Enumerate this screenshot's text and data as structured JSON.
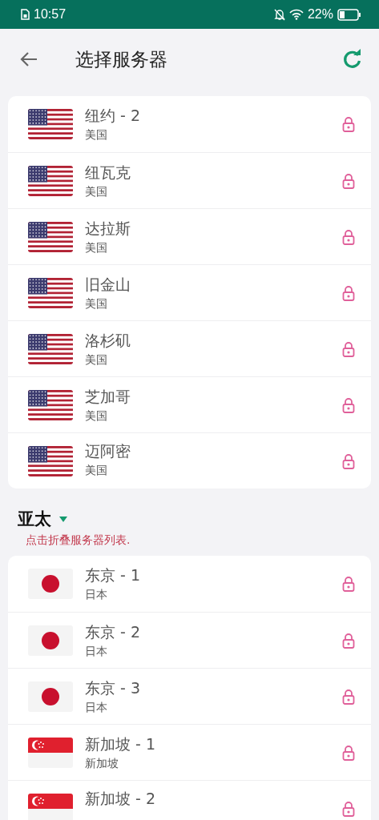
{
  "status_bar": {
    "time": "10:57",
    "battery": "22%"
  },
  "header": {
    "title": "选择服务器"
  },
  "groups": [
    {
      "servers": [
        {
          "name": "纽约 - 2",
          "country": "美国",
          "kind": "us",
          "locked": true
        },
        {
          "name": "纽瓦克",
          "country": "美国",
          "kind": "us",
          "locked": true
        },
        {
          "name": "达拉斯",
          "country": "美国",
          "kind": "us",
          "locked": true
        },
        {
          "name": "旧金山",
          "country": "美国",
          "kind": "us",
          "locked": true
        },
        {
          "name": "洛杉矶",
          "country": "美国",
          "kind": "us",
          "locked": true
        },
        {
          "name": "芝加哥",
          "country": "美国",
          "kind": "us",
          "locked": true
        },
        {
          "name": "迈阿密",
          "country": "美国",
          "kind": "us",
          "locked": true
        }
      ]
    },
    {
      "title": "亚太",
      "expanded": true,
      "hint": "点击折叠服务器列表.",
      "servers": [
        {
          "name": "东京 - 1",
          "country": "日本",
          "kind": "jp",
          "locked": true
        },
        {
          "name": "东京 - 2",
          "country": "日本",
          "kind": "jp",
          "locked": true
        },
        {
          "name": "东京 - 3",
          "country": "日本",
          "kind": "jp",
          "locked": true
        },
        {
          "name": "新加坡 - 1",
          "country": "新加坡",
          "kind": "sg",
          "locked": true
        },
        {
          "name": "新加坡 - 2",
          "kind": "sg",
          "locked": true
        }
      ]
    }
  ]
}
